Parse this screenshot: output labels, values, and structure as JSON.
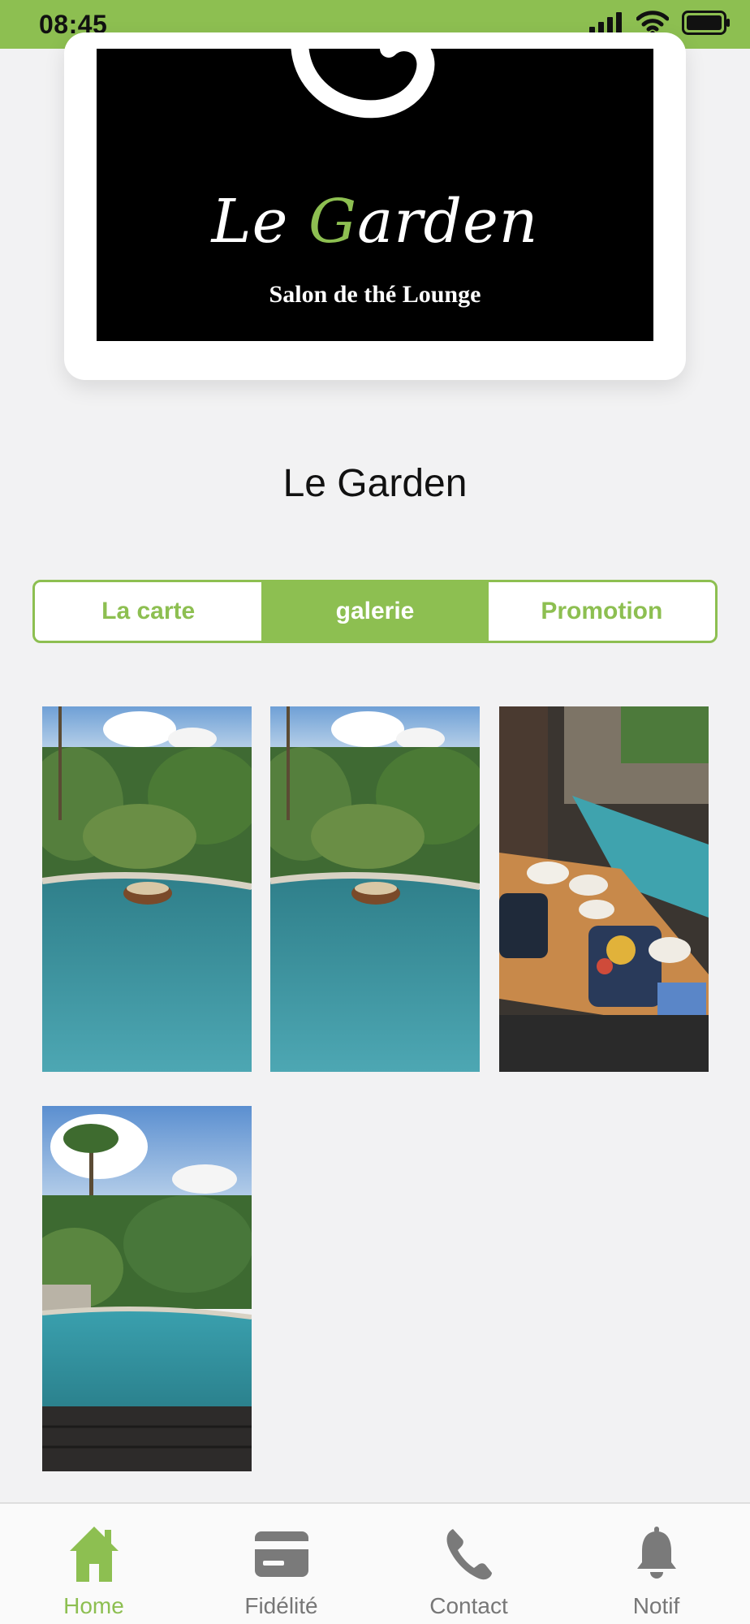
{
  "status_bar": {
    "time": "08:45"
  },
  "logo": {
    "script_text_le": "Le ",
    "script_text_g": "G",
    "script_text_rest": "arden",
    "tagline": "Salon de thé Lounge"
  },
  "page": {
    "title": "Le Garden"
  },
  "tabs": [
    {
      "label": "La carte",
      "active": false
    },
    {
      "label": "galerie",
      "active": true
    },
    {
      "label": "Promotion",
      "active": false
    }
  ],
  "gallery": [
    {
      "subject": "infinity pool with jungle view and floating tray"
    },
    {
      "subject": "infinity pool with jungle view and floating tray"
    },
    {
      "subject": "breakfast table beside the pool"
    },
    {
      "subject": "pool overlooking palm trees"
    }
  ],
  "bottom_nav": {
    "items": [
      {
        "label": "Home",
        "icon": "home-icon",
        "active": true
      },
      {
        "label": "Fidélité",
        "icon": "card-icon",
        "active": false
      },
      {
        "label": "Contact",
        "icon": "phone-icon",
        "active": false
      },
      {
        "label": "Notif",
        "icon": "bell-icon",
        "active": false
      }
    ]
  },
  "colors": {
    "accent": "#8dbf51",
    "background": "#f2f2f3",
    "inactive_icon": "#7a7a7a"
  }
}
